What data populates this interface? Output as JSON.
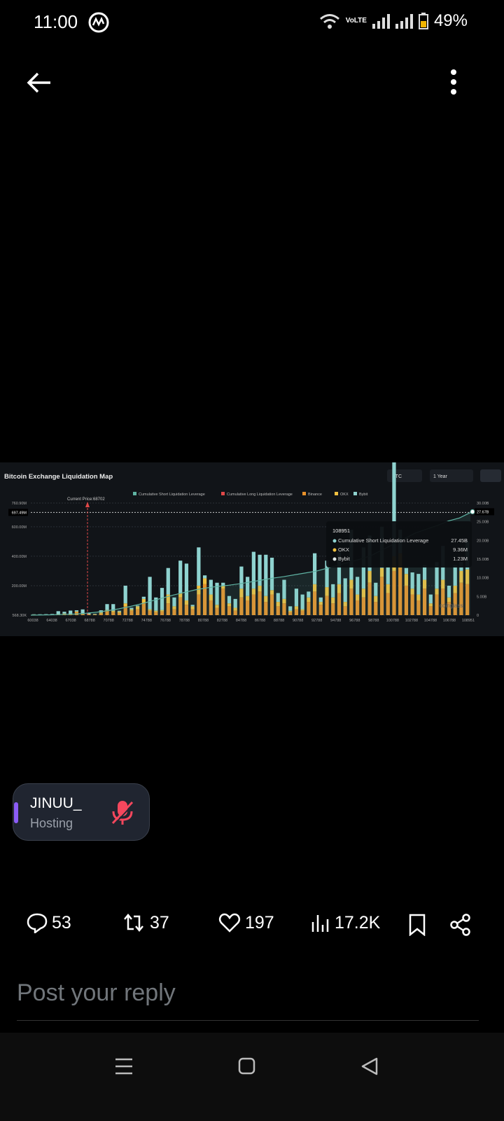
{
  "status": {
    "time": "11:00",
    "battery": "49%",
    "network": "VoLTE"
  },
  "topbar": {
    "back": "back-arrow-icon",
    "menu": "more-vertical-icon"
  },
  "chart_image": {
    "title": "Bitcoin Exchange Liquidation Map",
    "coin_select": "BTC",
    "range_select": "1 Year",
    "current_price_label": "Current Price:68702",
    "watermark": "coinglass",
    "legend": [
      "Cumulative Short Liquidation Leverage",
      "Cumulative Long Liquidation Leverage",
      "Binance",
      "OKX",
      "Bybit"
    ],
    "colors": {
      "short": "#5fb3a3",
      "long": "#e04848",
      "binance": "#e8912a",
      "okx": "#f0c040",
      "bybit": "#8fd3d0"
    },
    "left_ticks": [
      "760.90M",
      "600.00M",
      "400.00M",
      "200.00M",
      "568.30K"
    ],
    "left_highlight": "697.49M",
    "right_ticks": [
      "30.00B",
      "25.00B",
      "20.00B",
      "15.00B",
      "10.00B",
      "5.00B",
      "0"
    ],
    "right_highlight": "27.67B",
    "x_ticks": [
      "60038",
      "64038",
      "67038",
      "68788",
      "70788",
      "72788",
      "74788",
      "76788",
      "78788",
      "80788",
      "82788",
      "84788",
      "86788",
      "88788",
      "90788",
      "92788",
      "94788",
      "96788",
      "98788",
      "100788",
      "102788",
      "104788",
      "106788",
      "108951"
    ],
    "tooltip": {
      "title": "108951",
      "rows": [
        {
          "label": "Cumulative Short Liquidation Leverage",
          "value": "27.45B",
          "color": "#8fd3d0"
        },
        {
          "label": "OKX",
          "value": "9.36M",
          "color": "#f0c040"
        },
        {
          "label": "Bybit",
          "value": "1.23M",
          "color": "#dfe7e7"
        }
      ]
    }
  },
  "chart_data": {
    "type": "bar",
    "left_ylim": [
      0,
      760.9
    ],
    "right_ylim": [
      0,
      30
    ],
    "bars_M": [
      [
        3,
        1,
        2
      ],
      [
        2,
        1,
        3
      ],
      [
        4,
        1,
        2
      ],
      [
        3,
        2,
        3
      ],
      [
        5,
        2,
        20
      ],
      [
        8,
        3,
        12
      ],
      [
        4,
        2,
        25
      ],
      [
        20,
        5,
        8
      ],
      [
        6,
        3,
        30
      ],
      [
        5,
        2,
        10
      ],
      [
        4,
        2,
        3
      ],
      [
        10,
        8,
        15
      ],
      [
        25,
        10,
        40
      ],
      [
        20,
        10,
        45
      ],
      [
        15,
        10,
        5
      ],
      [
        60,
        20,
        120
      ],
      [
        30,
        10,
        10
      ],
      [
        40,
        20,
        5
      ],
      [
        80,
        30,
        15
      ],
      [
        30,
        10,
        220
      ],
      [
        20,
        10,
        90
      ],
      [
        25,
        10,
        150
      ],
      [
        80,
        60,
        180
      ],
      [
        40,
        20,
        60
      ],
      [
        120,
        30,
        220
      ],
      [
        70,
        30,
        250
      ],
      [
        40,
        20,
        10
      ],
      [
        140,
        60,
        260
      ],
      [
        210,
        40,
        20
      ],
      [
        100,
        40,
        100
      ],
      [
        50,
        20,
        150
      ],
      [
        180,
        20,
        20
      ],
      [
        60,
        20,
        50
      ],
      [
        30,
        20,
        60
      ],
      [
        120,
        60,
        150
      ],
      [
        100,
        30,
        130
      ],
      [
        140,
        40,
        250
      ],
      [
        160,
        40,
        210
      ],
      [
        90,
        40,
        280
      ],
      [
        140,
        30,
        220
      ],
      [
        60,
        30,
        60
      ],
      [
        80,
        30,
        130
      ],
      [
        20,
        10,
        30
      ],
      [
        40,
        20,
        120
      ],
      [
        30,
        10,
        100
      ],
      [
        90,
        30,
        40
      ],
      [
        160,
        50,
        210
      ],
      [
        70,
        20,
        30
      ],
      [
        130,
        60,
        180
      ],
      [
        80,
        40,
        90
      ],
      [
        150,
        60,
        220
      ],
      [
        60,
        30,
        160
      ],
      [
        180,
        60,
        340
      ],
      [
        100,
        40,
        120
      ],
      [
        120,
        60,
        280
      ],
      [
        220,
        80,
        240
      ],
      [
        90,
        40,
        90
      ],
      [
        260,
        60,
        280
      ],
      [
        150,
        60,
        120
      ],
      [
        300,
        100,
        640
      ],
      [
        320,
        100,
        160
      ],
      [
        200,
        80,
        40
      ],
      [
        140,
        40,
        110
      ],
      [
        100,
        40,
        140
      ],
      [
        180,
        60,
        100
      ],
      [
        60,
        20,
        60
      ],
      [
        140,
        40,
        180
      ],
      [
        180,
        60,
        230
      ],
      [
        90,
        30,
        80
      ],
      [
        150,
        50,
        140
      ],
      [
        220,
        80,
        60
      ],
      [
        210,
        100,
        190
      ]
    ],
    "cumulative_short_B": [
      0,
      0.05,
      0.1,
      0.2,
      0.3,
      0.5,
      0.8,
      1.2,
      1.7,
      2.3,
      3.0,
      3.8,
      4.6,
      5.4,
      6.1,
      6.8,
      7.3,
      7.7,
      8.0,
      8.4,
      8.9,
      9.4,
      9.9,
      10.3,
      10.8,
      11.3,
      11.8,
      12.6,
      13.4,
      14.2,
      15.0,
      16.0,
      17.5,
      19.0,
      20.5,
      22.0,
      23.0,
      24.0,
      25.2,
      26.0,
      27.45
    ]
  },
  "space_pill": {
    "name": "JINUU_",
    "role": "Hosting",
    "mic": "mic-muted-icon"
  },
  "actions": {
    "replies": "53",
    "reposts": "37",
    "likes": "197",
    "views": "17.2K"
  },
  "reply": {
    "placeholder": "Post your reply"
  }
}
